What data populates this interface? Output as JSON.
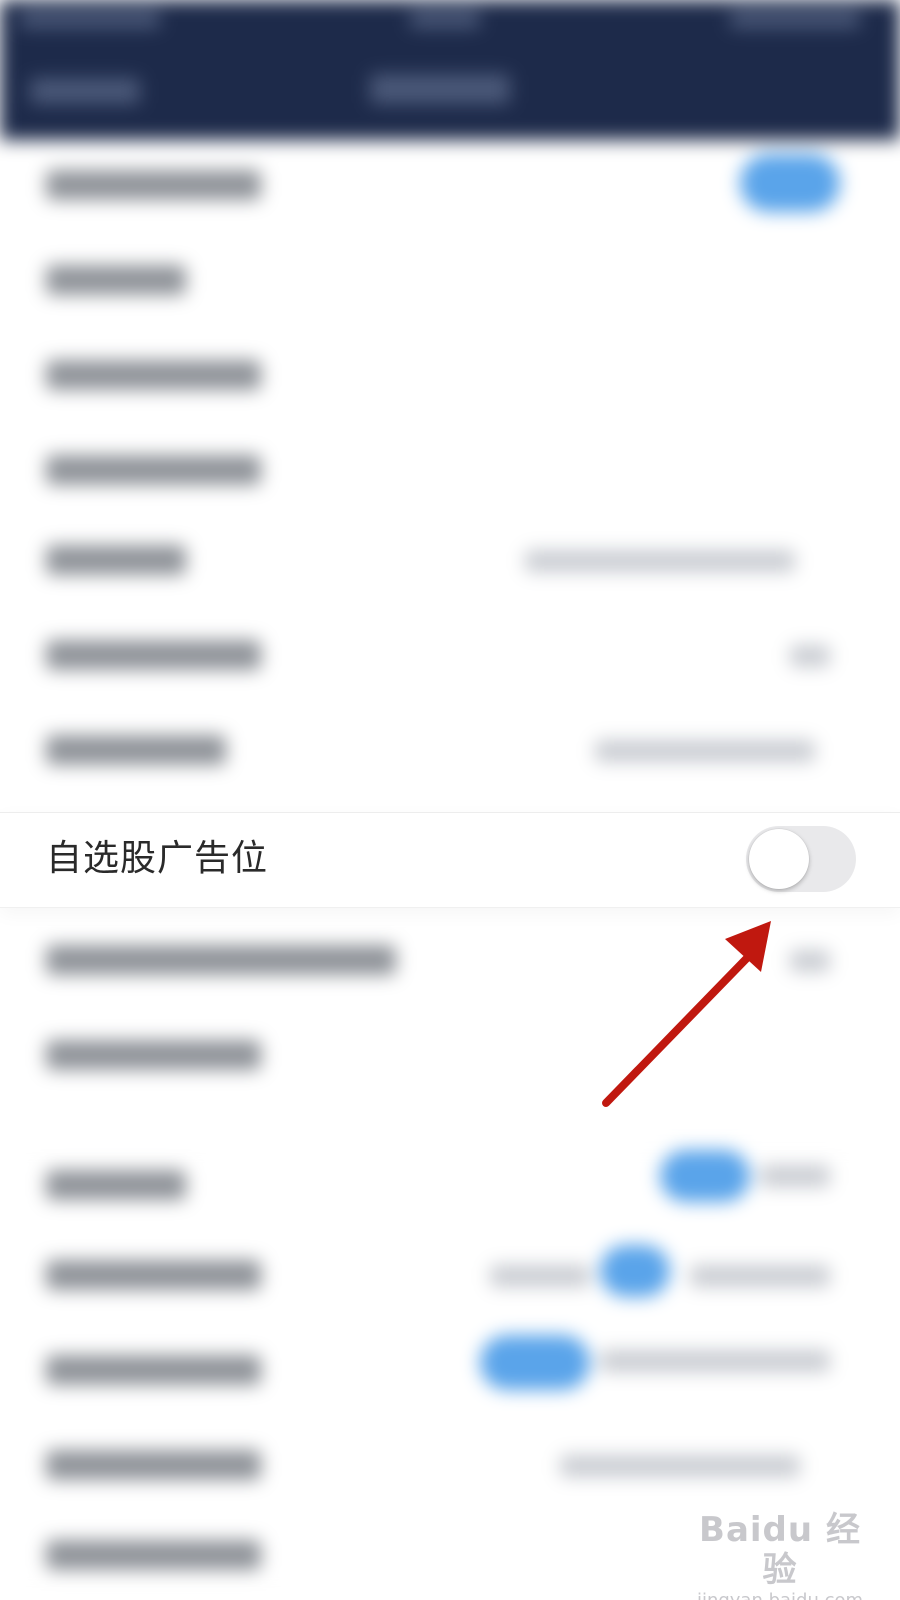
{
  "setting_row": {
    "label": "自选股广告位",
    "toggle": {
      "on": false
    }
  },
  "annotation": {
    "arrow_color": "#c0180f"
  },
  "watermark": {
    "logo_text": "Baidu 经验",
    "sub_text": "jingyan.baidu.com"
  },
  "colors": {
    "nav_background": "#1d2a4a",
    "accent_blue": "#5aa4ea",
    "toggle_off_track": "#e9e9eb"
  }
}
